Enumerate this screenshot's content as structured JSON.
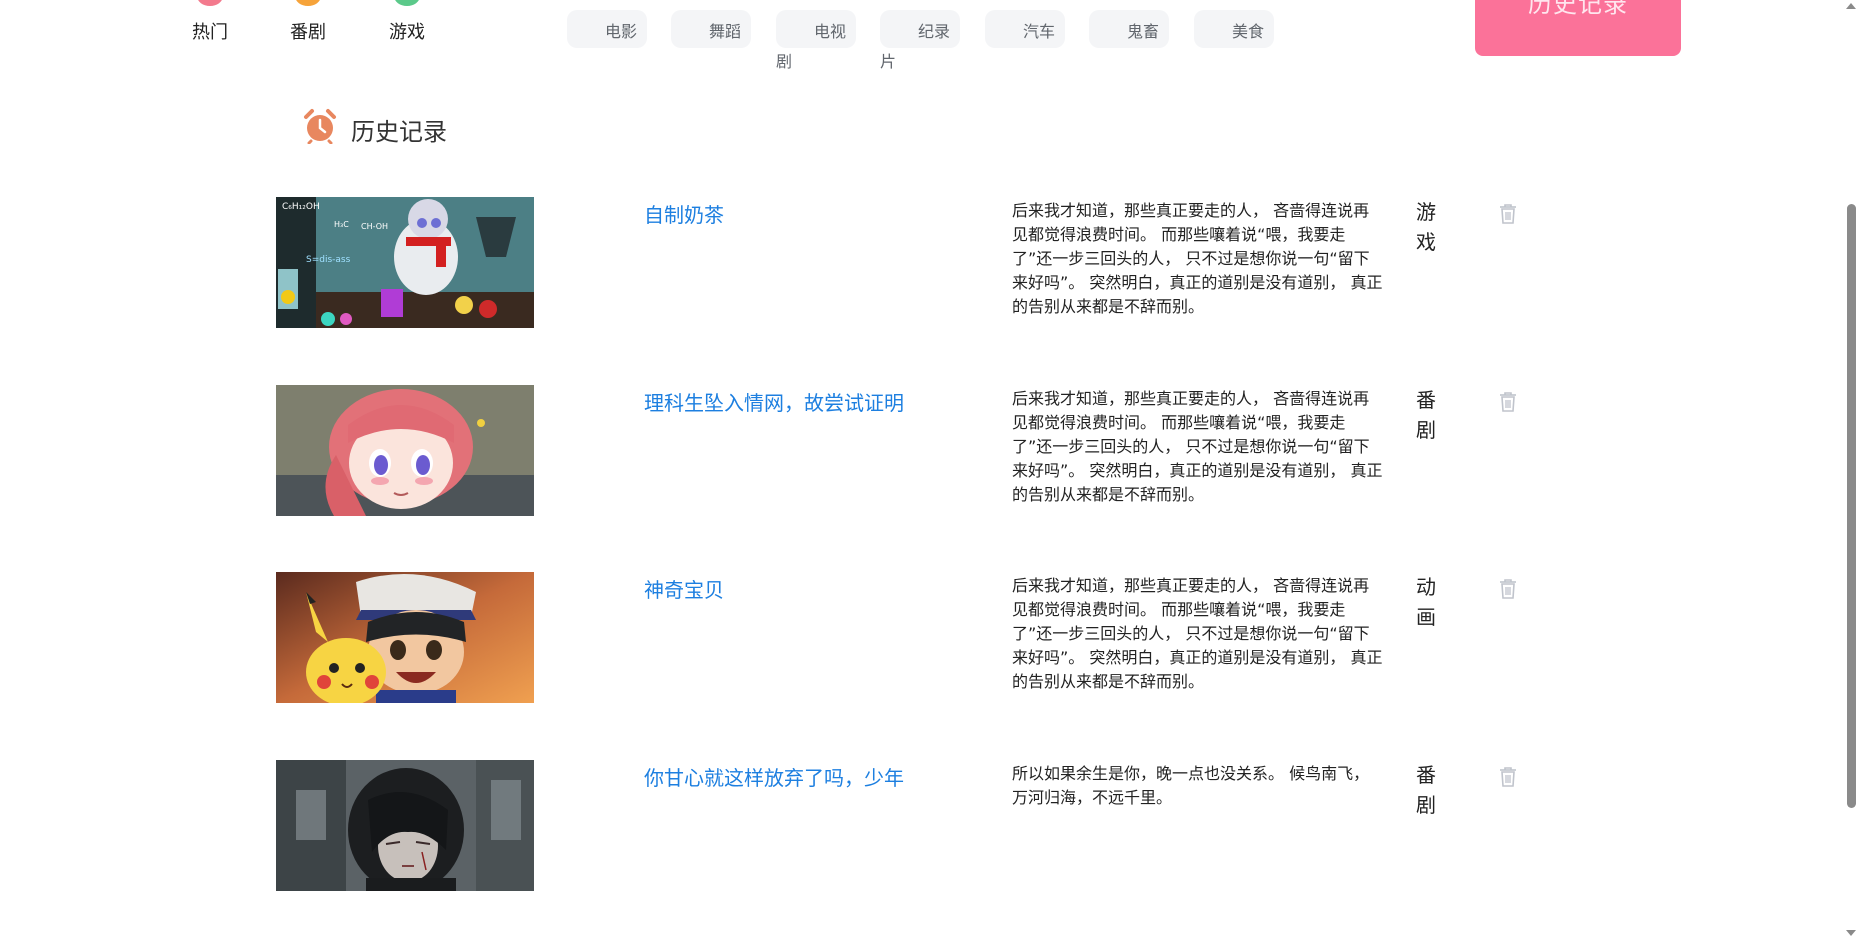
{
  "nav": {
    "categories": [
      {
        "label": "热门",
        "dot_color": "#f37a8d"
      },
      {
        "label": "番剧",
        "dot_color": "#f6a33a"
      },
      {
        "label": "游戏",
        "dot_color": "#5bc98a"
      }
    ],
    "tags": [
      {
        "label": "电影",
        "overflow": ""
      },
      {
        "label": "舞蹈",
        "overflow": ""
      },
      {
        "label": "电视",
        "overflow": "剧"
      },
      {
        "label": "纪录",
        "overflow": "片"
      },
      {
        "label": "汽车",
        "overflow": ""
      },
      {
        "label": "鬼畜",
        "overflow": ""
      },
      {
        "label": "美食",
        "overflow": ""
      }
    ],
    "history_button": "历史记录",
    "accent_color": "#fb7299"
  },
  "section": {
    "title": "历史记录",
    "icon": "alarm-clock-icon",
    "icon_color": "#e8875f"
  },
  "history": [
    {
      "title": "自制奶茶",
      "thumbnail": "chemistry-snowman-thumbnail",
      "description": "后来我才知道，那些真正要走的人， 吝啬得连说再见都觉得浪费时间。 而那些嚷着说“喂，我要走了”还一步三回头的人， 只不过是想你说一句“留下来好吗”。 突然明白，真正的道别是没有道别， 真正的告别从来都是不辞而别。",
      "category": "游戏"
    },
    {
      "title": "理科生坠入情网，故尝试证明",
      "thumbnail": "pink-hair-girl-thumbnail",
      "description": "后来我才知道，那些真正要走的人， 吝啬得连说再见都觉得浪费时间。 而那些嚷着说“喂，我要走了”还一步三回头的人， 只不过是想你说一句“留下来好吗”。 突然明白，真正的道别是没有道别， 真正的告别从来都是不辞而别。",
      "category": "番剧"
    },
    {
      "title": "神奇宝贝",
      "thumbnail": "ash-pikachu-thumbnail",
      "description": "后来我才知道，那些真正要走的人， 吝啬得连说再见都觉得浪费时间。 而那些嚷着说“喂，我要走了”还一步三回头的人， 只不过是想你说一句“留下来好吗”。 突然明白，真正的道别是没有道别， 真正的告别从来都是不辞而别。",
      "category": "动画"
    },
    {
      "title": "你甘心就这样放弃了吗，少年",
      "thumbnail": "dark-hair-boy-thumbnail",
      "description": "所以如果余生是你，晚一点也没关系。 候鸟南飞，万河归海，不远千里。",
      "category": "番剧"
    }
  ],
  "delete_icon": "trash-icon",
  "link_color": "#1d7fe0"
}
